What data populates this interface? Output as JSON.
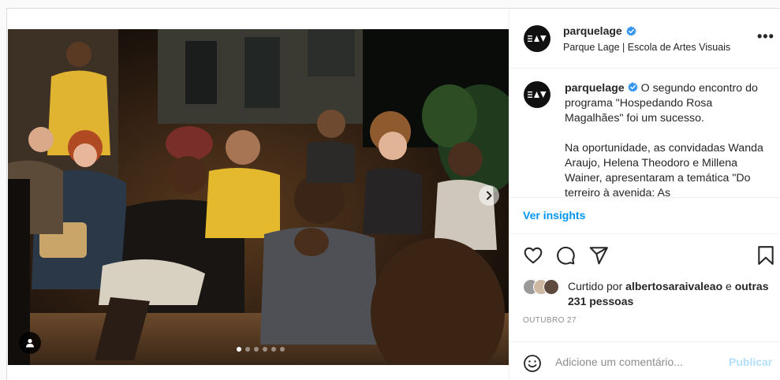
{
  "post": {
    "account": {
      "username": "parquelage",
      "subtitle": "Parque Lage | Escola de Artes Visuais",
      "logo_glyphs": "≡▲▼",
      "verified": true
    },
    "caption": {
      "username": "parquelage",
      "paragraph1": "O segundo encontro do programa \"Hospedando Rosa Magalhães\" foi um sucesso.",
      "paragraph2": "Na oportunidade, as convidadas Wanda Araujo, Helena Theodoro e Millena Wainer, apresentaram a temática \"Do terreiro à avenida: As"
    },
    "insights_link": "Ver insights",
    "actions": [
      "heart-icon",
      "comment-icon",
      "share-icon",
      "bookmark-icon"
    ],
    "likes": {
      "prefix": "Curtido por",
      "user": "albertosaraivaleao",
      "joiner": "e",
      "others": "outras 231 pessoas"
    },
    "date": "OUTUBRO 27",
    "comment": {
      "placeholder": "Adicione um comentário...",
      "publish_label": "Publicar"
    },
    "carousel": {
      "slide_count": 6,
      "current_slide": 1
    },
    "colors": {
      "link": "#0095f6",
      "publish_disabled": "#b2dffc",
      "verified": "#3897f0",
      "muted": "#8e8e8e"
    }
  }
}
